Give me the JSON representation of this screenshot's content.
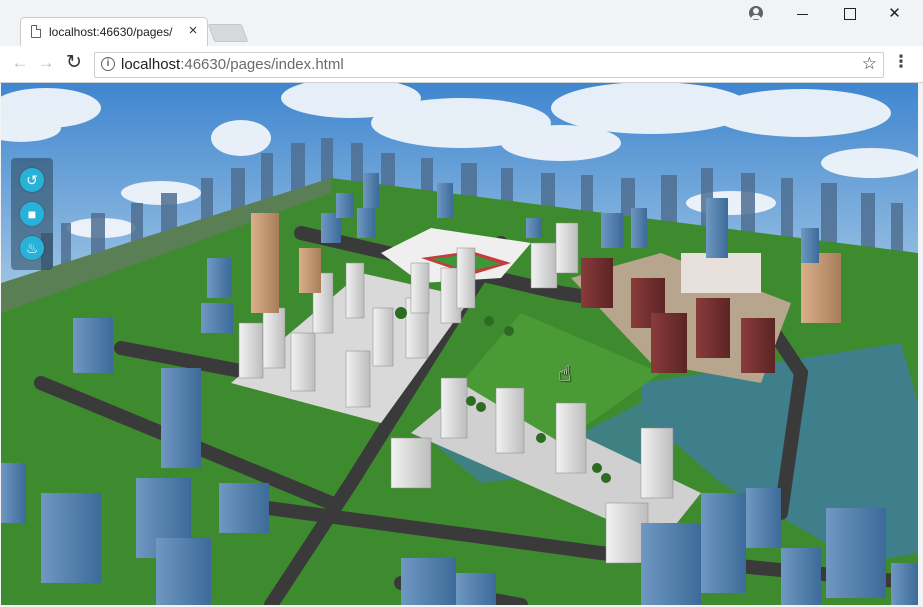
{
  "browser": {
    "tab_title": "localhost:46630/pages/",
    "tab_close": "×",
    "url_host": "localhost",
    "url_path": ":46630/pages/index.html",
    "star_icon": "☆",
    "menu_icon": "⋮"
  },
  "window": {
    "close_symbol": "✕"
  },
  "viewer": {
    "tools": [
      {
        "icon": "reset-view-icon",
        "glyph": "↺"
      },
      {
        "icon": "camera-tour-icon",
        "glyph": "■"
      },
      {
        "icon": "fire-icon",
        "glyph": "♨"
      }
    ]
  },
  "colors": {
    "grass": "#3e8a2e",
    "road": "#3a3a3a",
    "water": "#3f7f8c",
    "tool_button": "#28b2d8"
  }
}
